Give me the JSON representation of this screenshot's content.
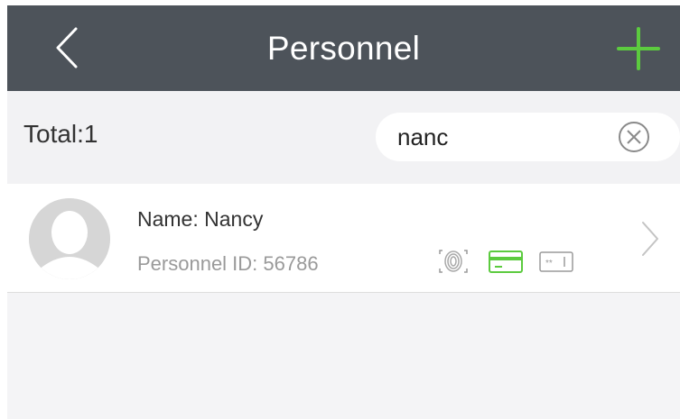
{
  "header": {
    "title": "Personnel",
    "back_icon": "chevron-left-icon",
    "add_icon": "plus-icon",
    "background_color": "#4d535a",
    "accent_color": "#5ccb3f"
  },
  "filter": {
    "total_label": "Total:1",
    "search_value": "nanc",
    "clear_icon": "clear-circle-icon"
  },
  "personnel": [
    {
      "name_label": "Name: Nancy",
      "id_label": "Personnel ID: 56786",
      "avatar_icon": "avatar-placeholder-icon",
      "credentials": [
        "fingerprint-icon",
        "card-icon",
        "password-icon"
      ],
      "chevron_icon": "chevron-right-icon"
    }
  ]
}
